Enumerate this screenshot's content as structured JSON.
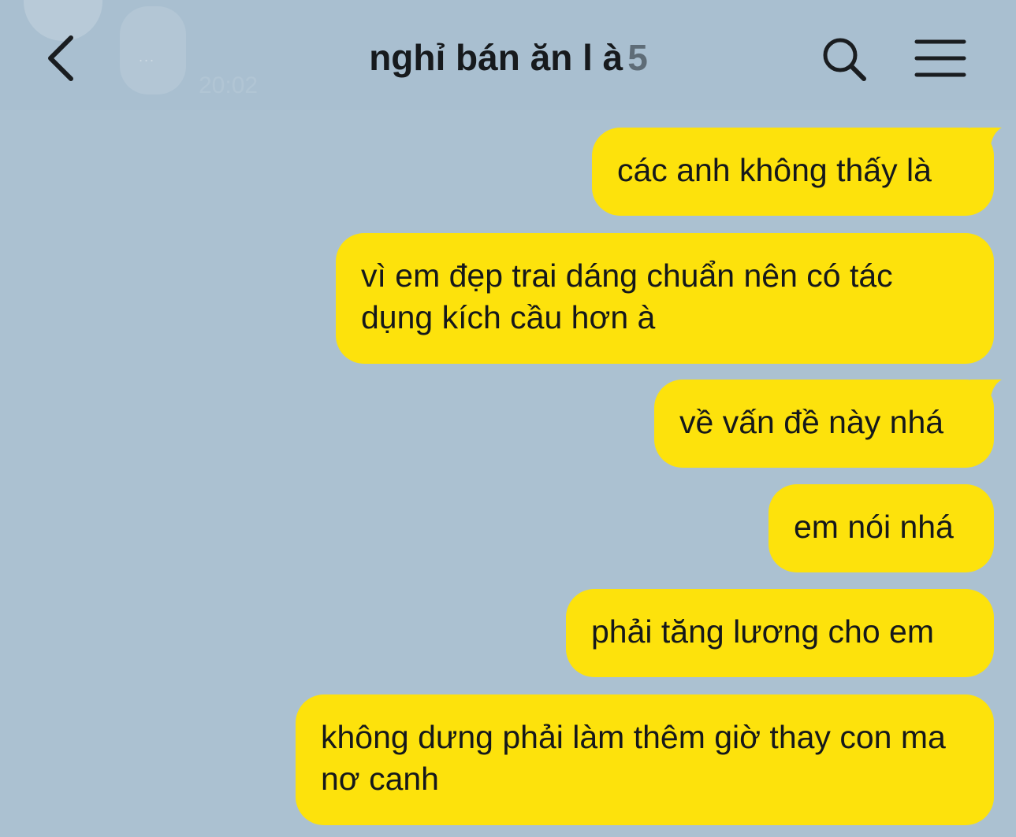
{
  "header": {
    "title": "nghỉ bán ăn l à",
    "member_count": "5",
    "background_time": "20:02",
    "background_typing_dots": "...",
    "back_icon": "chevron-left-icon",
    "search_icon": "search-icon",
    "menu_icon": "hamburger-menu-icon"
  },
  "colors": {
    "background": "#abc1d1",
    "bubble": "#fde20c",
    "text": "#15181b"
  },
  "messages": [
    {
      "text": "các anh không thấy là",
      "sender": "me",
      "has_tail": true
    },
    {
      "text": "vì em đẹp trai dáng chuẩn nên có tác dụng kích cầu hơn à",
      "sender": "me",
      "has_tail": false
    },
    {
      "text": "về vấn đề này nhá",
      "sender": "me",
      "has_tail": true
    },
    {
      "text": "em nói nhá",
      "sender": "me",
      "has_tail": false
    },
    {
      "text": "phải tăng lương cho em",
      "sender": "me",
      "has_tail": false
    },
    {
      "text": "không dưng phải làm thêm giờ thay con ma nơ canh",
      "sender": "me",
      "has_tail": false
    }
  ]
}
